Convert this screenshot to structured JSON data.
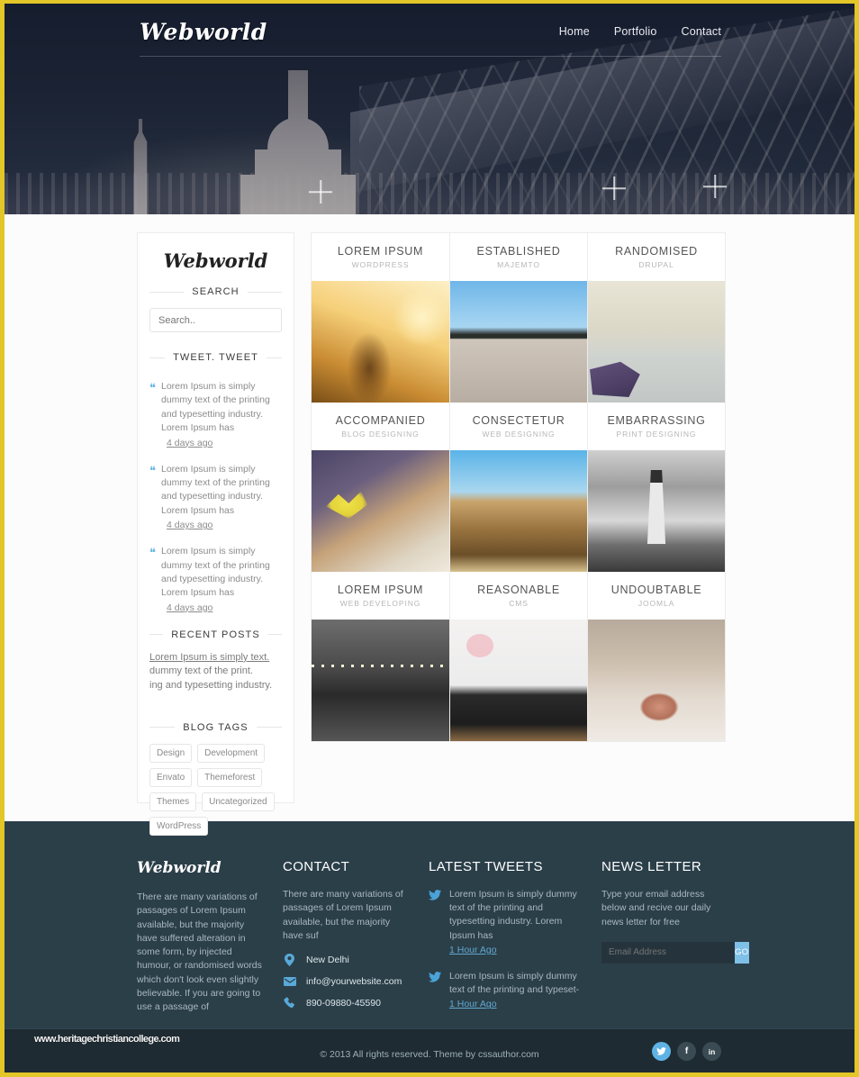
{
  "brand": {
    "name": "Webworld"
  },
  "nav": {
    "items": [
      "Home",
      "Portfolio",
      "Contact"
    ]
  },
  "sidebar": {
    "logo": "Webworld",
    "search": {
      "heading": "SEARCH",
      "placeholder": "Search.."
    },
    "tweets": {
      "heading": "TWEET. TWEET",
      "items": [
        {
          "text": "Lorem Ipsum is simply dummy text of the printing and typesetting industry. Lorem Ipsum has",
          "time": "4 days ago"
        },
        {
          "text": "Lorem Ipsum is simply dummy text of the printing and typesetting industry. Lorem Ipsum has",
          "time": "4 days ago"
        },
        {
          "text": "Lorem Ipsum is simply dummy text of the printing and typesetting industry. Lorem Ipsum has",
          "time": "4 days ago"
        }
      ]
    },
    "recent_posts": {
      "heading": "RECENT POSTS",
      "link_line": "Lorem Ipsum is simply text.",
      "line2": "dummy text of the print.",
      "line3": "ing and typesetting industry."
    },
    "blog_tags": {
      "heading": "BLOG TAGS",
      "items": [
        "Design",
        "Development",
        "Envato",
        "Themeforest",
        "Themes",
        "Uncategorized",
        "WordPress"
      ]
    }
  },
  "portfolio": {
    "rows": [
      {
        "captions": [
          {
            "title": "LOREM IPSUM",
            "subtitle": "WORDPRESS"
          },
          {
            "title": "ESTABLISHED",
            "subtitle": "MAJEMTO"
          },
          {
            "title": "RANDOMISED",
            "subtitle": "DRUPAL"
          }
        ],
        "thumbs": [
          "girl-in-sunset-field-photo",
          "wooden-dock-blue-sky-photo",
          "moored-boat-and-bird-photo"
        ]
      },
      {
        "captions": [
          {
            "title": "ACCOMPANIED",
            "subtitle": "BLOG DESIGNING"
          },
          {
            "title": "CONSECTETUR",
            "subtitle": "WEB DESIGNING"
          },
          {
            "title": "EMBARRASSING",
            "subtitle": "PRINT DESIGNING"
          }
        ],
        "thumbs": [
          "yellow-leaf-on-rocks-photo",
          "desert-canyon-landscape-photo",
          "black-white-lighthouse-photo"
        ]
      },
      {
        "captions": [
          {
            "title": "LOREM IPSUM",
            "subtitle": "WEB DEVELOPING"
          },
          {
            "title": "REASONABLE",
            "subtitle": "CMS"
          },
          {
            "title": "UNDOUBTABLE",
            "subtitle": "JOOMLA"
          }
        ],
        "thumbs": [
          "brooklyn-bridge-night-photo",
          "turntable-needle-photo",
          "cat-nose-closeup-photo"
        ]
      }
    ]
  },
  "footer": {
    "about": {
      "logo": "Webworld",
      "text": "There are many variations of passages of Lorem Ipsum available, but the majority have suffered alteration in some form, by injected humour, or randomised words which don't look even slightly believable. If you are going to use a passage of"
    },
    "contact": {
      "heading": "CONTACT",
      "text": "There are many variations of passages of Lorem Ipsum available, but the majority have suf",
      "address": "New Delhi",
      "email": "info@yourwebsite.com",
      "phone": "890-09880-45590"
    },
    "latest_tweets": {
      "heading": "LATEST TWEETS",
      "items": [
        {
          "text": "Lorem Ipsum is simply dummy text of the printing and typesetting industry. Lorem Ipsum has",
          "time": "1 Hour Ago"
        },
        {
          "text": "Lorem Ipsum is simply dummy text of the printing and typeset-",
          "time": "1 Hour Ago"
        }
      ]
    },
    "newsletter": {
      "heading": "NEWS LETTER",
      "text": "Type your email address below and recive our daily news letter for free",
      "placeholder": "Email Address",
      "button": "GO"
    }
  },
  "bottom": {
    "watermark": "www.heritagechristiancollege.com",
    "copyright": "© 2013 All rights reserved.  Theme by cssauthor.com",
    "socials": [
      "twitter",
      "facebook",
      "linkedin"
    ]
  },
  "colors": {
    "accent_yellow": "#e3c627",
    "footer_bg": "#2b3f49",
    "bottom_bg": "#1e2b33",
    "link_blue": "#5eb3e4"
  }
}
